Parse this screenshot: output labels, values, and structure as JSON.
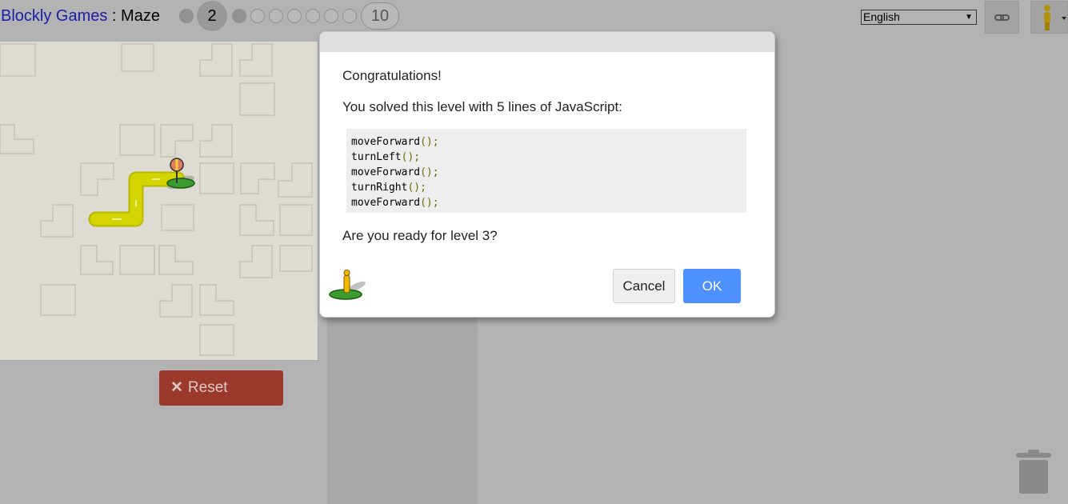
{
  "header": {
    "app_link": "Blockly Games",
    "separator": " : ",
    "game": "Maze",
    "current_level": "2",
    "last_level": "10",
    "language": "English"
  },
  "reset_label": "Reset",
  "dialog": {
    "congrats": "Congratulations!",
    "solved": "You solved this level with 5 lines of JavaScript:",
    "code_lines": [
      {
        "name": "moveForward",
        "paren": "();"
      },
      {
        "name": "turnLeft",
        "paren": "();"
      },
      {
        "name": "moveForward",
        "paren": "();"
      },
      {
        "name": "turnRight",
        "paren": "();"
      },
      {
        "name": "moveForward",
        "paren": "();"
      }
    ],
    "ready": "Are you ready for level 3?",
    "cancel": "Cancel",
    "ok": "OK"
  },
  "colors": {
    "ok_button": "#4d90fe",
    "reset_button": "#9b3a2c",
    "path": "#d4d400"
  },
  "icons": {
    "link": "link-icon",
    "pegman": "pegman-icon",
    "trash": "trash-icon",
    "reset": "close-icon",
    "finish": "finish-marker-icon"
  }
}
